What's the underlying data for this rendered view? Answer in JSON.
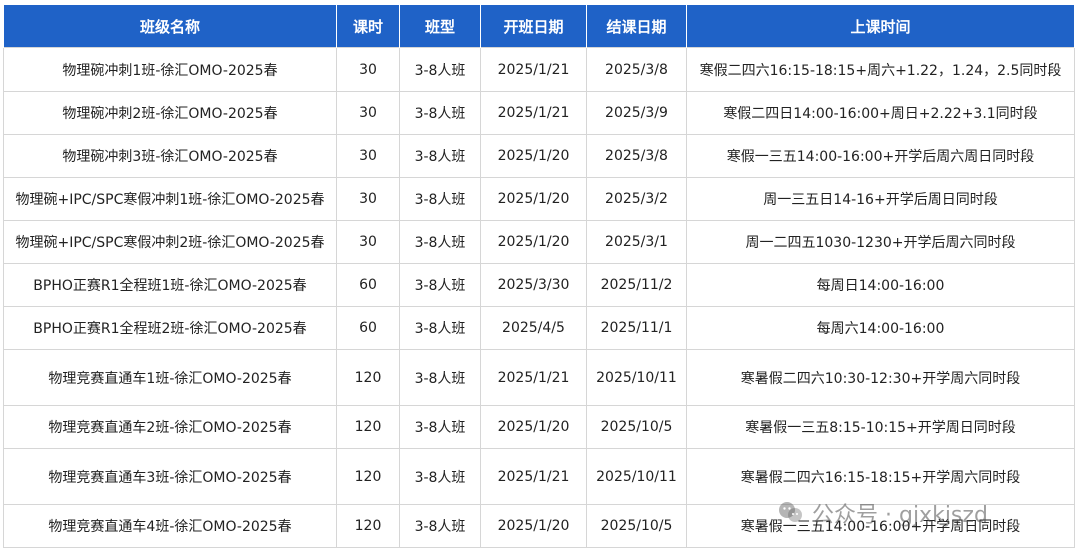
{
  "table": {
    "headers": [
      "班级名称",
      "课时",
      "班型",
      "开班日期",
      "结课日期",
      "上课时间"
    ],
    "rows": [
      [
        "物理碗冲刺1班-徐汇OMO-2025春",
        "30",
        "3-8人班",
        "2025/1/21",
        "2025/3/8",
        "寒假二四六16:15-18:15+周六+1.22，1.24，2.5同时段"
      ],
      [
        "物理碗冲刺2班-徐汇OMO-2025春",
        "30",
        "3-8人班",
        "2025/1/21",
        "2025/3/9",
        "寒假二四日14:00-16:00+周日+2.22+3.1同时段"
      ],
      [
        "物理碗冲刺3班-徐汇OMO-2025春",
        "30",
        "3-8人班",
        "2025/1/20",
        "2025/3/8",
        "寒假一三五14:00-16:00+开学后周六周日同时段"
      ],
      [
        "物理碗+IPC/SPC寒假冲刺1班-徐汇OMO-2025春",
        "30",
        "3-8人班",
        "2025/1/20",
        "2025/3/2",
        "周一三五日14-16+开学后周日同时段"
      ],
      [
        "物理碗+IPC/SPC寒假冲刺2班-徐汇OMO-2025春",
        "30",
        "3-8人班",
        "2025/1/20",
        "2025/3/1",
        "周一二四五1030-1230+开学后周六同时段"
      ],
      [
        "BPHO正赛R1全程班1班-徐汇OMO-2025春",
        "60",
        "3-8人班",
        "2025/3/30",
        "2025/11/2",
        "每周日14:00-16:00"
      ],
      [
        "BPHO正赛R1全程班2班-徐汇OMO-2025春",
        "60",
        "3-8人班",
        "2025/4/5",
        "2025/11/1",
        "每周六14:00-16:00"
      ],
      [
        "物理竞赛直通车1班-徐汇OMO-2025春",
        "120",
        "3-8人班",
        "2025/1/21",
        "2025/10/11",
        "寒暑假二四六10:30-12:30+开学周六同时段"
      ],
      [
        "物理竞赛直通车2班-徐汇OMO-2025春",
        "120",
        "3-8人班",
        "2025/1/20",
        "2025/10/5",
        "寒暑假一三五8:15-10:15+开学周日同时段"
      ],
      [
        "物理竞赛直通车3班-徐汇OMO-2025春",
        "120",
        "3-8人班",
        "2025/1/21",
        "2025/10/11",
        "寒暑假二四六16:15-18:15+开学周六同时段"
      ],
      [
        "物理竞赛直通车4班-徐汇OMO-2025春",
        "120",
        "3-8人班",
        "2025/1/20",
        "2025/10/5",
        "寒暑假一三五14:00-16:00+开学周日同时段"
      ]
    ]
  },
  "watermark": {
    "text": "公众号 · gjxkjszd",
    "icon": "wechat-icon"
  },
  "colors": {
    "header_bg": "#1f62c7",
    "header_text": "#ffffff",
    "border": "#d6d6d6"
  }
}
